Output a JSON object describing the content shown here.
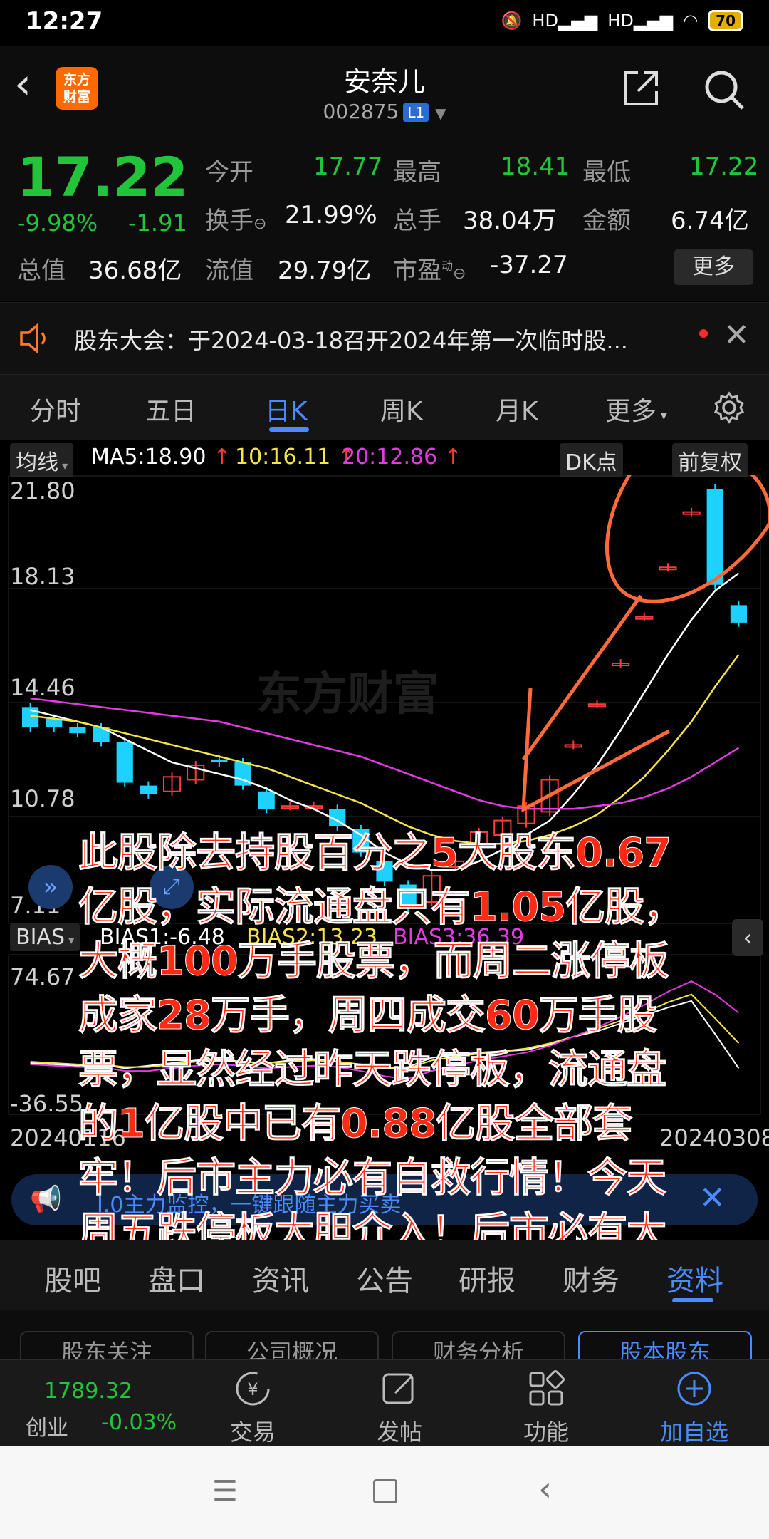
{
  "status_bar": {
    "time": "12:27",
    "network1": "HD",
    "network2": "HD",
    "battery": "70"
  },
  "header": {
    "logo_line1": "东方",
    "logo_line2": "财富",
    "stock_name": "安奈儿",
    "stock_code": "002875",
    "level_badge": "L1"
  },
  "quote": {
    "price": "17.22",
    "change_pct": "-9.98%",
    "change_abs": "-1.91",
    "open_label": "今开",
    "open": "17.77",
    "high_label": "最高",
    "high": "18.41",
    "low_label": "最低",
    "low": "17.22",
    "turnover_label": "换手",
    "turnover": "21.99%",
    "volume_label": "总手",
    "volume": "38.04万",
    "amount_label": "金额",
    "amount": "6.74亿",
    "mktcap_label": "总值",
    "mktcap": "36.68亿",
    "float_label": "流值",
    "float_cap": "29.79亿",
    "pe_label": "市盈",
    "pe_super": "动",
    "pe": "-37.27",
    "more_button": "更多"
  },
  "announcement": {
    "text": "股东大会：于2024-03-18召开2024年第一次临时股..."
  },
  "chart_tabs": [
    "分时",
    "五日",
    "日K",
    "周K",
    "月K",
    "更多"
  ],
  "chart_tabs_active": "日K",
  "ma_bar": {
    "label": "均线",
    "ma5": "MA5:18.90",
    "ma10": "10:16.11",
    "ma20": "20:12.86",
    "dk_button": "DK点",
    "adjust_button": "前复权"
  },
  "price_axis": [
    "21.80",
    "18.13",
    "14.46",
    "10.78",
    "7.11"
  ],
  "bias_bar": {
    "label": "BIAS",
    "bias1": "BIAS1:-6.48",
    "bias2": "BIAS2:13.23",
    "bias3": "BIAS3:36.39"
  },
  "bias_axis": {
    "top": "74.67",
    "bottom": "-36.55"
  },
  "date_axis": {
    "start": "20240116",
    "end": "20240308"
  },
  "promo": {
    "text": "Ⅰ.0主力监控，一键跟随主力买卖"
  },
  "overlay_text": "此股除去持股百分之5大股东0.67亿股，实际流通盘只有1.05亿股，大概100万手股票，而周二涨停板成家28万手，周四成交60万手股票，显然经过昨天跌停板，流通盘的1亿股中已有0.88亿股全部套牢！后市主力必有自救行情！今天周五跌停板大胆介入！后市必有大肉吃!",
  "section_tabs": [
    "股吧",
    "盘口",
    "资讯",
    "公告",
    "研报",
    "财务",
    "资料"
  ],
  "section_tabs_active": "资料",
  "sub_buttons": [
    "股东关注",
    "公司概况",
    "财务分析",
    "股本股东"
  ],
  "bottom_nav": {
    "index_value": "1789.32",
    "index_name": "创业",
    "index_change": "-0.03%",
    "trade": "交易",
    "post": "发帖",
    "functions": "功能",
    "add_watch": "加自选"
  },
  "colors": {
    "up": "#ff3b3b",
    "down": "#22c43a",
    "accent": "#4a8cff",
    "overlay": "#ff2a14"
  },
  "chart_data": {
    "type": "candlestick",
    "ylim": [
      7.11,
      21.8
    ],
    "candles": [
      {
        "o": 14.3,
        "c": 13.6
      },
      {
        "o": 13.9,
        "c": 13.6
      },
      {
        "o": 13.6,
        "c": 13.4
      },
      {
        "o": 13.6,
        "c": 13.1
      },
      {
        "o": 13.1,
        "c": 11.7
      },
      {
        "o": 11.6,
        "c": 11.3
      },
      {
        "o": 11.4,
        "c": 11.9
      },
      {
        "o": 11.8,
        "c": 12.3
      },
      {
        "o": 12.5,
        "c": 12.4
      },
      {
        "o": 12.4,
        "c": 11.6
      },
      {
        "o": 11.4,
        "c": 10.8
      },
      {
        "o": 10.9,
        "c": 10.9
      },
      {
        "o": 10.9,
        "c": 10.9
      },
      {
        "o": 10.8,
        "c": 10.2
      },
      {
        "o": 10.1,
        "c": 9.3
      },
      {
        "o": 9.0,
        "c": 8.3
      },
      {
        "o": 8.2,
        "c": 7.4
      },
      {
        "o": 7.6,
        "c": 8.5
      },
      {
        "o": 8.8,
        "c": 9.0
      },
      {
        "o": 9.5,
        "c": 10.0
      },
      {
        "o": 9.9,
        "c": 10.4
      },
      {
        "o": 10.3,
        "c": 10.9
      },
      {
        "o": 10.7,
        "c": 11.8
      },
      {
        "o": 13.0,
        "c": 13.0
      },
      {
        "o": 14.4,
        "c": 14.4
      },
      {
        "o": 15.8,
        "c": 15.8
      },
      {
        "o": 17.4,
        "c": 17.4
      },
      {
        "o": 19.1,
        "c": 19.1
      },
      {
        "o": 21.0,
        "c": 21.0
      },
      {
        "o": 21.8,
        "c": 18.5
      },
      {
        "o": 17.8,
        "c": 17.2
      }
    ],
    "ma5": [
      14.2,
      14.0,
      13.8,
      13.6,
      13.2,
      12.8,
      12.4,
      12.2,
      12.0,
      11.8,
      11.5,
      11.1,
      10.8,
      10.4,
      9.9,
      9.3,
      8.9,
      8.7,
      8.7,
      9.0,
      9.4,
      9.9,
      10.4,
      11.3,
      12.3,
      13.5,
      14.8,
      16.1,
      17.3,
      18.3,
      18.9
    ],
    "ma10": [
      14.0,
      13.9,
      13.8,
      13.6,
      13.4,
      13.2,
      13.0,
      12.8,
      12.6,
      12.4,
      12.2,
      11.9,
      11.6,
      11.3,
      11.0,
      10.6,
      10.2,
      9.9,
      9.7,
      9.6,
      9.6,
      9.7,
      9.9,
      10.2,
      10.6,
      11.2,
      11.9,
      12.8,
      13.8,
      15.0,
      16.1
    ],
    "ma20": [
      14.6,
      14.5,
      14.4,
      14.3,
      14.2,
      14.1,
      14.0,
      13.9,
      13.8,
      13.6,
      13.4,
      13.2,
      13.0,
      12.8,
      12.6,
      12.3,
      12.0,
      11.7,
      11.4,
      11.1,
      10.9,
      10.8,
      10.8,
      10.8,
      10.9,
      11.0,
      11.2,
      11.5,
      11.9,
      12.4,
      12.9
    ],
    "bias_ylim": [
      -36.55,
      74.67
    ],
    "bias1": [
      -2,
      -3,
      -4,
      -3,
      -6,
      -4,
      -2,
      0,
      1,
      -1,
      -2,
      0,
      1,
      -1,
      -3,
      -6,
      -5,
      2,
      4,
      6,
      7,
      8,
      12,
      18,
      22,
      28,
      34,
      40,
      45,
      20,
      -6
    ],
    "bias2": [
      -1,
      -2,
      -3,
      -3,
      -5,
      -5,
      -3,
      -1,
      0,
      -1,
      -2,
      -1,
      0,
      -1,
      -3,
      -6,
      -6,
      0,
      3,
      5,
      7,
      9,
      13,
      18,
      24,
      30,
      36,
      44,
      50,
      32,
      13
    ],
    "bias3": [
      -3,
      -4,
      -5,
      -5,
      -8,
      -8,
      -6,
      -4,
      -3,
      -4,
      -6,
      -5,
      -4,
      -5,
      -8,
      -12,
      -14,
      -8,
      -4,
      0,
      3,
      6,
      11,
      18,
      25,
      33,
      42,
      52,
      60,
      50,
      36
    ]
  }
}
